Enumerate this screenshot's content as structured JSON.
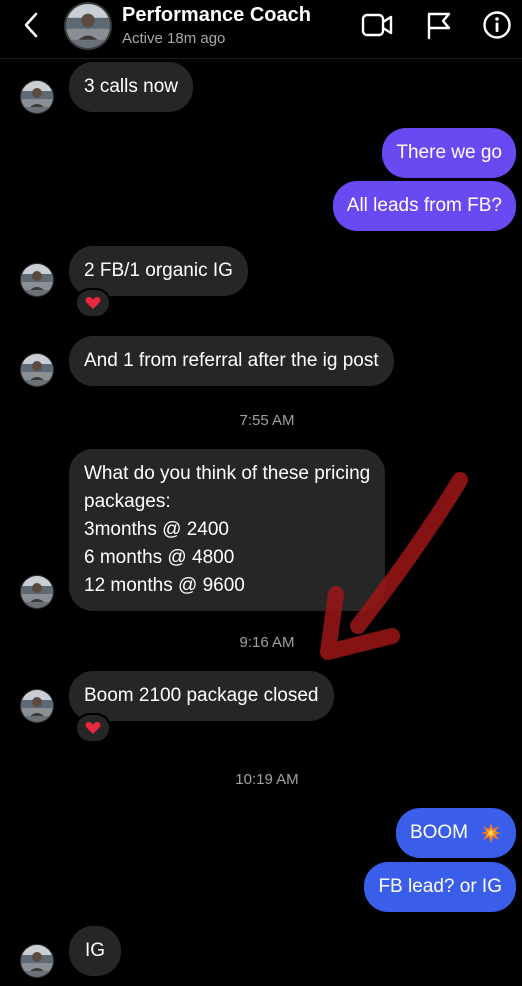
{
  "header": {
    "title": "Performance Coach",
    "status": "Active 18m ago",
    "icons": [
      "chevron-left-icon",
      "video-camera-icon",
      "flag-icon",
      "info-icon"
    ]
  },
  "messages": [
    {
      "side": "incoming",
      "text": "3 calls now"
    },
    {
      "side": "outgoing",
      "text": "There we go"
    },
    {
      "side": "outgoing",
      "text": "All leads from FB?"
    },
    {
      "side": "incoming",
      "text": "2 FB/1 organic IG",
      "reaction": "heart"
    },
    {
      "side": "incoming",
      "text": "And 1 from referral after the ig post"
    },
    {
      "timestamp": "7:55 AM"
    },
    {
      "side": "incoming",
      "text": "What do you think of these pricing\npackages:\n3months @ 2400\n6 months @ 4800\n12 months @ 9600"
    },
    {
      "timestamp": "9:16 AM"
    },
    {
      "side": "incoming",
      "text": "Boom 2100 package closed",
      "reaction": "heart"
    },
    {
      "timestamp": "10:19 AM"
    },
    {
      "side": "outgoing",
      "text": "BOOM",
      "emoji": "collision"
    },
    {
      "side": "outgoing",
      "text": "FB lead? or IG"
    },
    {
      "side": "incoming",
      "text": "IG"
    }
  ],
  "colors": {
    "incoming_bubble": "#262626",
    "outgoing_purple": "#6a49f3",
    "outgoing_blue": "#3a5ee9",
    "annotation_arrow": "#a01818"
  }
}
